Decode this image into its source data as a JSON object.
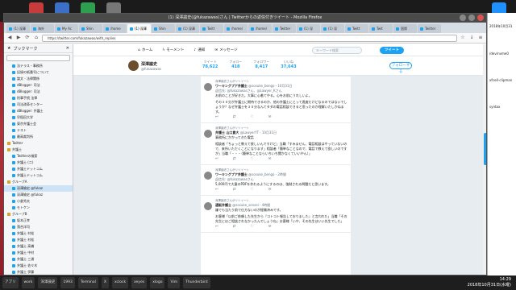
{
  "browser": {
    "window_title": "(1) 深澤諭史(@fukazawas)さん | Twitterからの返信付きツイート - Mozilla Firefox",
    "url": "https://twitter.com/fukazawas/with_replies",
    "tabs": [
      "(1) 深澤",
      "海外",
      "My Ac",
      "Shin",
      "/home",
      "(1) 深澤",
      "Shin",
      "(1) 深澤",
      "Twitt",
      "/home/",
      "/home/",
      "Twitter",
      "(1) 深",
      "(1) 深",
      "Twitt",
      "Twit",
      "国際",
      "Twitter"
    ],
    "active_tab_index": 5
  },
  "sidebar": {
    "title": "ブックマーク",
    "items": [
      {
        "label": "法テラス・事務所",
        "type": "link"
      },
      {
        "label": "記録の紙番号について",
        "type": "link"
      },
      {
        "label": "論文 - 法律関係",
        "type": "link"
      },
      {
        "label": "dBlogger: 司法",
        "type": "link"
      },
      {
        "label": "dBlogger: 司法",
        "type": "link"
      },
      {
        "label": "刑事手続 法律",
        "type": "link"
      },
      {
        "label": "司法改革センター",
        "type": "link"
      },
      {
        "label": "dBlogger: 弁護士",
        "type": "link"
      },
      {
        "label": "早稲田大学",
        "type": "link"
      },
      {
        "label": "東京弁護士会",
        "type": "link"
      },
      {
        "label": "テスト",
        "type": "link"
      },
      {
        "label": "最高裁判所",
        "type": "link"
      },
      {
        "label": "Twitter",
        "type": "folder"
      },
      {
        "label": "弁護士",
        "type": "folder"
      },
      {
        "label": "Twitterの検索",
        "type": "link"
      },
      {
        "label": "弁護士 (二)",
        "type": "link"
      },
      {
        "label": "弁護士ドットコム",
        "type": "link"
      },
      {
        "label": "弁護士ドットコム",
        "type": "link"
      },
      {
        "label": "グループA",
        "type": "folder"
      },
      {
        "label": "深澤諭史 @fukaz",
        "type": "link",
        "selected": true
      },
      {
        "label": "深澤諭史 @fukaz",
        "type": "link"
      },
      {
        "label": "小倉秀夫",
        "type": "link"
      },
      {
        "label": "モトケン",
        "type": "link"
      },
      {
        "label": "グループB",
        "type": "folder"
      },
      {
        "label": "坂本正幸",
        "type": "link"
      },
      {
        "label": "落合洋司",
        "type": "link"
      },
      {
        "label": "弁護士 村松",
        "type": "link"
      },
      {
        "label": "弁護士 村松",
        "type": "link"
      },
      {
        "label": "弁護士 高橋",
        "type": "link"
      },
      {
        "label": "弁護士 中村",
        "type": "link"
      },
      {
        "label": "弁護士 三浦",
        "type": "link"
      },
      {
        "label": "弁護士 佐々木",
        "type": "link"
      },
      {
        "label": "弁護士 伊藤",
        "type": "link"
      },
      {
        "label": "Shoko Egawa",
        "type": "link"
      }
    ]
  },
  "twitter": {
    "nav": [
      "ホーム",
      "モーメント",
      "通知",
      "メッセージ"
    ],
    "search_placeholder": "キーワード検索",
    "tweet_button": "ツイート",
    "profile": {
      "name": "深澤諭史",
      "handle": "@fukazawas",
      "stats": [
        {
          "label": "ツイート",
          "value": "78,622"
        },
        {
          "label": "フォロー",
          "value": "418"
        },
        {
          "label": "フォロワー",
          "value": "8,417"
        },
        {
          "label": "いいね",
          "value": "37,643"
        }
      ],
      "follow_button": "フォローする"
    },
    "tweets": [
      {
        "context": "深澤諭史さんがリツイート",
        "name": "ワーキングプア弁護士",
        "handle": "@sosuke_bengo",
        "date": "10月31日",
        "reply_to": "返信先: @fukazawasさん、@Lawyer_Kさん",
        "body": "お前のことが好きだ。大事に心着てやる。心をお前にうれしいよ。",
        "body2": "その３０分が弁護士に期待できるのか、他の弁護士にとって過度だけどなるのではないでしょうか？なぜ弁護士を３０分なんてタダの電話相談できると思ったのか理解いたしかねます。"
      },
      {
        "context": "深澤諭史さんがリツイート",
        "name": "弁護士 山口貴大",
        "handle": "@LawyerYT",
        "date": "10月31日",
        "reply_to": "",
        "body": "事務所にかかってきた電話",
        "body2": "相談者「ちょっと教えて欲しいんですけど」当職「すみません、電話相談はやっていないので、来所いただくことになります」相談者「簡単なことなので、電話で教えて欲しいのですが」当職「・・・（簡単なことならいちいち聞かなくていいやん）」"
      },
      {
        "context": "深澤諭史さんがリツイート",
        "name": "ワーキングプア弁護士",
        "handle": "@sosuke_bengo",
        "date": "2時間",
        "reply_to": "返信先: @fukazawasさん",
        "body": "5,000円で大量のPDFを作れるようにするのは、強制される問題だと思います。",
        "body2": ""
      },
      {
        "context": "深澤諭史さんがリツイート",
        "name": "通販弁護士",
        "handle": "@sosuke_sensei",
        "date": "4時間",
        "reply_to": "",
        "body": "嫌でも当たり前で仕方ないのが経験済みです。",
        "body2": "お客様「以前ご依頼した先生から『コトコト報告しておりました』と言われた」当職「その先生にはご相談されなかったんでしょうね」お客様「いや、その先生はいい先生でした」"
      }
    ],
    "action_icons": [
      "reply-icon",
      "retweet-icon",
      "like-icon",
      "message-icon"
    ]
  },
  "right_panel": {
    "lines": [
      "2018年10月31",
      "/dev/nvme0",
      "xfce4-clipman",
      "syntax"
    ]
  },
  "taskbar": {
    "items": [
      "アプリ",
      "work",
      "深澤諭史",
      "1993",
      "Terminal",
      "X",
      "xclock",
      "xeyes",
      "xlogo",
      "Vim",
      "Thunderbird"
    ],
    "time": "14:29",
    "date": "2018年10月31日(水曜)"
  },
  "colors": {
    "twitter_blue": "#1da1f2",
    "desktop_red": "#9f1f2a",
    "taskbar": "#1e1e1e"
  }
}
